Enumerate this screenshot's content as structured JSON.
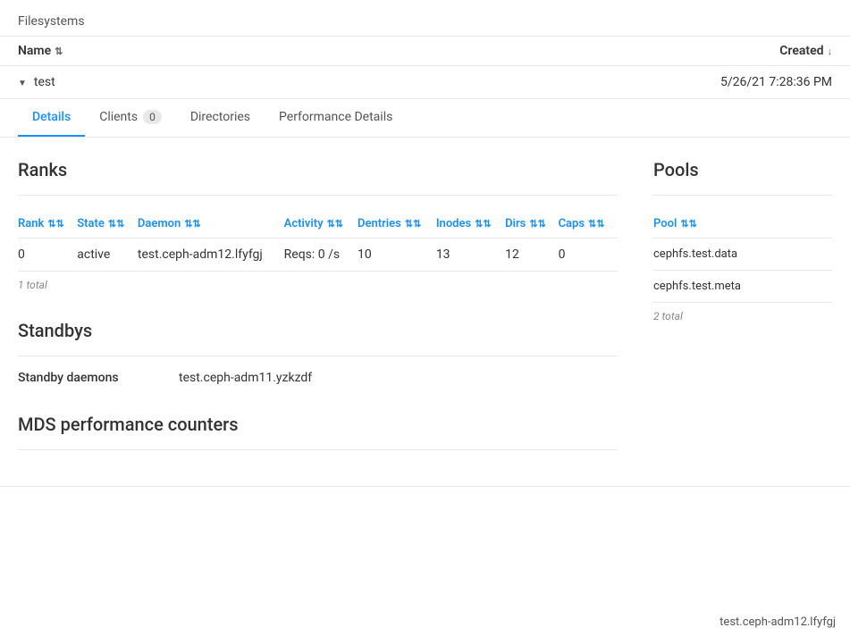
{
  "page": {
    "breadcrumb": "Filesystems"
  },
  "table_header": {
    "name_col": "Name",
    "created_col": "Created"
  },
  "filesystem": {
    "name": "test",
    "created": "5/26/21 7:28:36 PM"
  },
  "tabs": [
    {
      "id": "details",
      "label": "Details",
      "badge": null,
      "active": true
    },
    {
      "id": "clients",
      "label": "Clients",
      "badge": "0",
      "active": false
    },
    {
      "id": "directories",
      "label": "Directories",
      "badge": null,
      "active": false
    },
    {
      "id": "performance_details",
      "label": "Performance Details",
      "badge": null,
      "active": false
    }
  ],
  "ranks": {
    "title": "Ranks",
    "columns": [
      "Rank",
      "State",
      "Daemon",
      "Activity",
      "Dentries",
      "Inodes",
      "Dirs",
      "Caps"
    ],
    "rows": [
      {
        "rank": "0",
        "state": "active",
        "daemon": "test.ceph-adm12.lfyfgj",
        "activity": "Reqs: 0 /s",
        "dentries": "10",
        "inodes": "13",
        "dirs": "12",
        "caps": "0"
      }
    ],
    "total_label": "1 total"
  },
  "pools": {
    "title": "Pools",
    "column": "Pool",
    "rows": [
      {
        "name": "cephfs.test.data"
      },
      {
        "name": "cephfs.test.meta"
      }
    ],
    "total_label": "2 total"
  },
  "standbys": {
    "title": "Standbys",
    "label": "Standby daemons",
    "value": "test.ceph-adm11.yzkzdf"
  },
  "mds_performance": {
    "title": "MDS performance counters",
    "footer_label": "test.ceph-adm12.lfyfgj"
  }
}
